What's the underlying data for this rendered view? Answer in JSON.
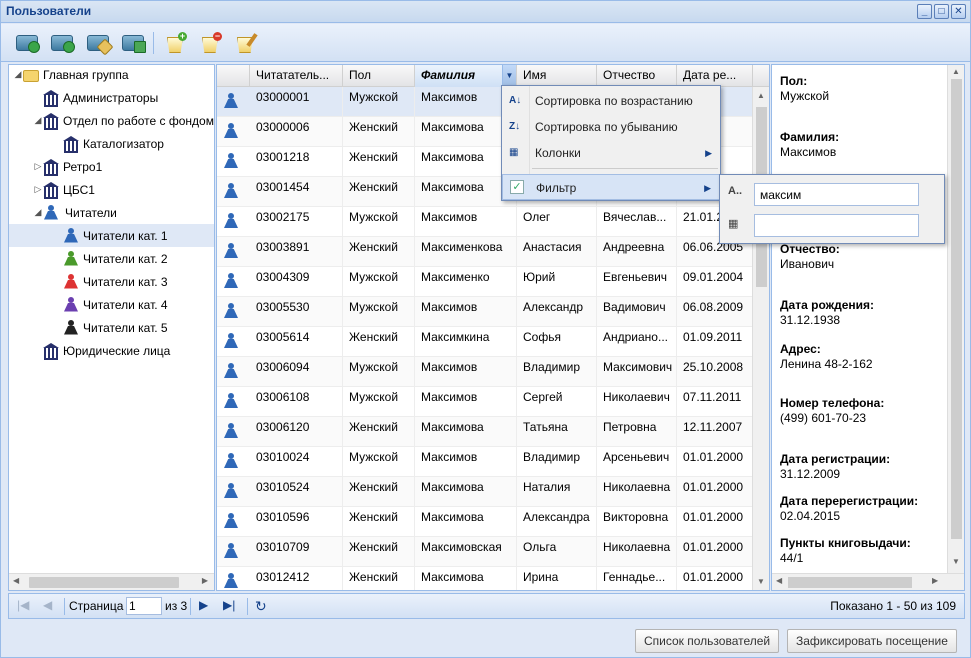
{
  "window": {
    "title": "Пользователи",
    "buttons": [
      "_",
      "□",
      "✕"
    ]
  },
  "toolbar": {
    "buttons": [
      "add-user",
      "add-user-2",
      "edit-user",
      "download-user",
      "add-bucket",
      "remove-bucket",
      "clean-bucket"
    ]
  },
  "tree": {
    "items": [
      {
        "label": "Главная группа",
        "level": 0,
        "arrow": "◢",
        "icon": "folder-icon"
      },
      {
        "label": "Администраторы",
        "level": 1,
        "arrow": "",
        "icon": "building-icon"
      },
      {
        "label": "Отдел по работе с фондом",
        "level": 1,
        "arrow": "◢",
        "icon": "building-icon"
      },
      {
        "label": "Каталогизатор",
        "level": 2,
        "arrow": "",
        "icon": "building-icon"
      },
      {
        "label": "Ретро1",
        "level": 1,
        "arrow": "▷",
        "icon": "building-icon"
      },
      {
        "label": "ЦБС1",
        "level": 1,
        "arrow": "▷",
        "icon": "building-icon"
      },
      {
        "label": "Читатели",
        "level": 1,
        "arrow": "◢",
        "icon": "group-icon"
      },
      {
        "label": "Читатели кат. 1",
        "level": 2,
        "arrow": "",
        "icon": "person-icon",
        "color": "#2f68b8",
        "selected": true
      },
      {
        "label": "Читатели кат. 2",
        "level": 2,
        "arrow": "",
        "icon": "person-icon",
        "color": "#4a9a2b"
      },
      {
        "label": "Читатели кат. 3",
        "level": 2,
        "arrow": "",
        "icon": "person-icon",
        "color": "#d33"
      },
      {
        "label": "Читатели кат. 4",
        "level": 2,
        "arrow": "",
        "icon": "person-icon",
        "color": "#6b3fb0"
      },
      {
        "label": "Читатели кат. 5",
        "level": 2,
        "arrow": "",
        "icon": "person-icon",
        "color": "#222"
      },
      {
        "label": "Юридические лица",
        "level": 1,
        "arrow": "",
        "icon": "building-icon"
      }
    ]
  },
  "grid": {
    "columns": [
      "Читатательский",
      "Пол",
      "Фамилия",
      "Имя",
      "Отчество",
      "Дата ре..."
    ],
    "columns_display": [
      "Читататель...",
      "Пол",
      "Фамилия",
      "Имя",
      "Отчество",
      "Дата ре..."
    ],
    "rows": [
      [
        "03000001",
        "Мужской",
        "Максимов",
        "",
        "",
        "009"
      ],
      [
        "03000006",
        "Женский",
        "Максимова",
        "",
        "",
        "011"
      ],
      [
        "03001218",
        "Женский",
        "Максимова",
        "",
        "",
        "999"
      ],
      [
        "03001454",
        "Женский",
        "Максимова",
        "",
        "",
        ""
      ],
      [
        "03002175",
        "Мужской",
        "Максимов",
        "Олег",
        "Вячеслав...",
        "21.01.2"
      ],
      [
        "03003891",
        "Женский",
        "Максименкова",
        "Анастасия",
        "Андреевна",
        "06.06.2005"
      ],
      [
        "03004309",
        "Мужской",
        "Максименко",
        "Юрий",
        "Евгеньевич",
        "09.01.2004"
      ],
      [
        "03005530",
        "Мужской",
        "Максимов",
        "Александр",
        "Вадимович",
        "06.08.2009"
      ],
      [
        "03005614",
        "Женский",
        "Максимкина",
        "Софья",
        "Андриано...",
        "01.09.2011"
      ],
      [
        "03006094",
        "Мужской",
        "Максимов",
        "Владимир",
        "Максимович",
        "25.10.2008"
      ],
      [
        "03006108",
        "Мужской",
        "Максимов",
        "Сергей",
        "Николаевич",
        "07.11.2011"
      ],
      [
        "03006120",
        "Женский",
        "Максимова",
        "Татьяна",
        "Петровна",
        "12.11.2007"
      ],
      [
        "03010024",
        "Мужской",
        "Максимов",
        "Владимир",
        "Арсеньевич",
        "01.01.2000"
      ],
      [
        "03010524",
        "Женский",
        "Максимова",
        "Наталия",
        "Николаевна",
        "01.01.2000"
      ],
      [
        "03010596",
        "Женский",
        "Максимова",
        "Александра",
        "Викторовна",
        "01.01.2000"
      ],
      [
        "03010709",
        "Женский",
        "Максимовская",
        "Ольга",
        "Николаевна",
        "01.01.2000"
      ],
      [
        "03012412",
        "Женский",
        "Максимова",
        "Ирина",
        "Геннадье...",
        "01.01.2000"
      ]
    ]
  },
  "column_menu": {
    "items": [
      {
        "label": "Сортировка по возрастанию",
        "icon": "sort-asc-icon",
        "glyph": "A↓"
      },
      {
        "label": "Сортировка по убыванию",
        "icon": "sort-desc-icon",
        "glyph": "Z↓"
      },
      {
        "label": "Колонки",
        "icon": "columns-icon",
        "glyph": "▦"
      },
      {
        "label": "Фильтр",
        "icon": "filter-check-icon",
        "glyph": "✓"
      }
    ]
  },
  "filter": {
    "text_value": "максим",
    "second_value": ""
  },
  "detail": {
    "fields": [
      {
        "label": "Пол:",
        "value": "Мужской"
      },
      {
        "label": "Фамилия:",
        "value": "Максимов"
      },
      {
        "label": "Отчество:",
        "value": "Иванович"
      },
      {
        "label": "Дата рождения:",
        "value": "31.12.1938"
      },
      {
        "label": "Адрес:",
        "value": "Ленина 48-2-162"
      },
      {
        "label": "Номер телефона:",
        "value": "(499) 601-70-23"
      },
      {
        "label": "Дата регистрации:",
        "value": "31.12.2009"
      },
      {
        "label": "Дата перерегистрации:",
        "value": "02.04.2015"
      },
      {
        "label": "Пункты книговыдачи:",
        "value": "44/1"
      }
    ]
  },
  "pager": {
    "page_label": "Страница",
    "page_value": "1",
    "of_label": "из 3",
    "summary": "Показано 1 - 50 из 109"
  },
  "buttons": {
    "user_list": "Список пользователей",
    "register_visit": "Зафиксировать посещение"
  }
}
